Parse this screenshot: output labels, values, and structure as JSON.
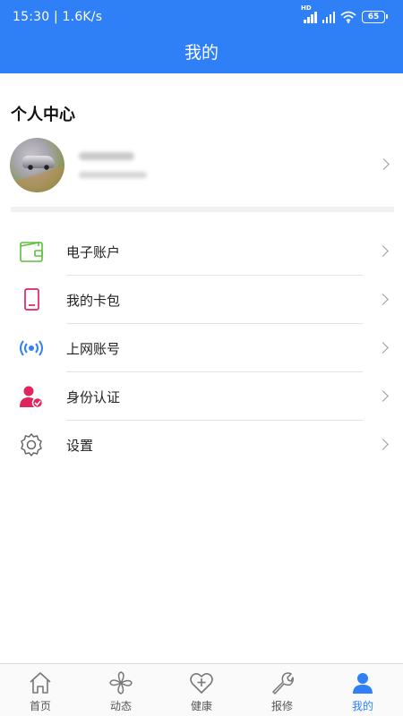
{
  "status_bar": {
    "time_speed": "15:30 | 1.6K/s",
    "signal_tag": "HD",
    "battery": "65"
  },
  "header": {
    "title": "我的"
  },
  "profile": {
    "section_title": "个人中心"
  },
  "menu": {
    "items": [
      {
        "label": "电子账户",
        "icon": "wallet-icon",
        "color": "#5cc03a"
      },
      {
        "label": "我的卡包",
        "icon": "card-icon",
        "color": "#e0245e"
      },
      {
        "label": "上网账号",
        "icon": "wireless-icon",
        "color": "#2f80f7"
      },
      {
        "label": "身份认证",
        "icon": "user-verified-icon",
        "color": "#e0245e"
      },
      {
        "label": "设置",
        "icon": "gear-icon",
        "color": "#666666"
      }
    ]
  },
  "tabbar": {
    "tabs": [
      {
        "label": "首页",
        "icon": "home-icon"
      },
      {
        "label": "动态",
        "icon": "pinwheel-icon"
      },
      {
        "label": "健康",
        "icon": "heart-plus-icon"
      },
      {
        "label": "报修",
        "icon": "wrench-icon"
      },
      {
        "label": "我的",
        "icon": "user-icon",
        "active": true
      }
    ],
    "active_color": "#2f80f7"
  },
  "colors": {
    "primary": "#2f80f7"
  }
}
